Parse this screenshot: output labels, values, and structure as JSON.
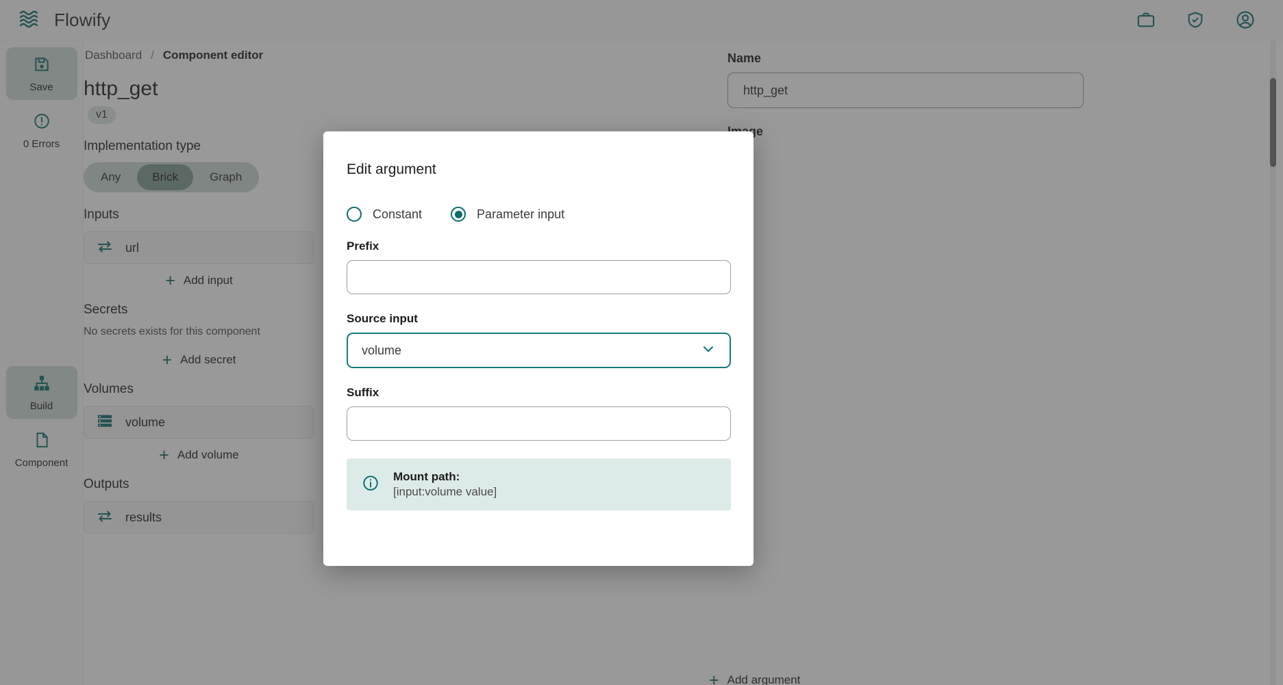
{
  "brand": {
    "name": "Flowify",
    "logo_icon": "waves-icon"
  },
  "topbar": {
    "icons": [
      {
        "name": "briefcase-icon"
      },
      {
        "name": "shield-check-icon"
      },
      {
        "name": "account-circle-icon"
      }
    ]
  },
  "sidebar": {
    "items": [
      {
        "label": "Save",
        "icon": "save-floppy-icon",
        "active": true
      },
      {
        "label": "0 Errors",
        "icon": "error-circle-icon",
        "active": false
      },
      {
        "label": "Build",
        "icon": "hierarchy-icon",
        "active": true
      },
      {
        "label": "Component",
        "icon": "document-icon",
        "active": false
      }
    ]
  },
  "breadcrumb": {
    "root": "Dashboard",
    "separator": "/",
    "current": "Component editor"
  },
  "component": {
    "title": "http_get",
    "version": "v1",
    "implementation_label": "Implementation type",
    "implementation_options": [
      "Any",
      "Brick",
      "Graph"
    ],
    "implementation_selected": "Brick"
  },
  "sections": {
    "inputs": {
      "label": "Inputs",
      "items": [
        {
          "name": "url",
          "icon": "transfer-arrows-icon"
        }
      ],
      "add_label": "Add input"
    },
    "secrets": {
      "label": "Secrets",
      "empty_text": "No secrets exists for this component",
      "add_label": "Add secret"
    },
    "volumes": {
      "label": "Volumes",
      "items": [
        {
          "name": "volume",
          "icon": "storage-icon"
        }
      ],
      "add_label": "Add volume"
    },
    "outputs": {
      "label": "Outputs",
      "items": [
        {
          "name": "results",
          "icon": "transfer-arrows-icon"
        }
      ]
    }
  },
  "right_panel": {
    "name_label": "Name",
    "name_value": "http_get",
    "image_label": "Image",
    "add_argument_label": "Add argument"
  },
  "modal": {
    "title": "Edit argument",
    "radios": [
      {
        "label": "Constant",
        "selected": false
      },
      {
        "label": "Parameter input",
        "selected": true
      }
    ],
    "prefix": {
      "label": "Prefix",
      "value": "",
      "placeholder": ""
    },
    "source_input": {
      "label": "Source input",
      "value": "volume",
      "options": [
        "volume"
      ],
      "chevron_icon": "chevron-down-icon"
    },
    "suffix": {
      "label": "Suffix",
      "value": "",
      "placeholder": ""
    },
    "info": {
      "icon": "info-circle-icon",
      "title": "Mount path:",
      "body": "[input:volume value]"
    }
  },
  "colors": {
    "accent": "#0c6b6b",
    "accent_border": "#147a7a",
    "info_bg": "#ddebe8",
    "active_nav": "#cfdcd6"
  }
}
